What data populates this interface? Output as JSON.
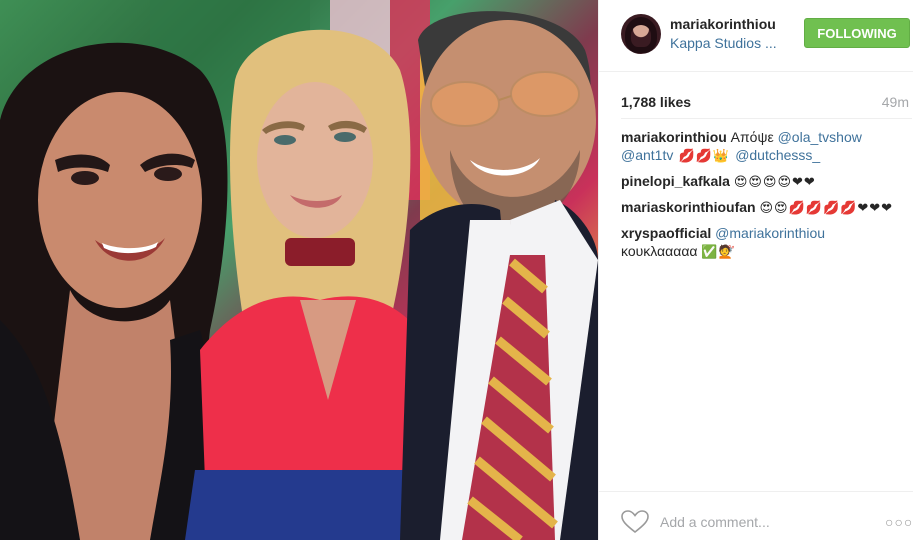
{
  "post": {
    "photo_alt": "",
    "username": "mariakorinthiou",
    "location": "Kappa Studios ...",
    "follow_label": "FOLLOWING",
    "likes": "1,788 likes",
    "age": "49m",
    "add_comment_placeholder": "Add a comment...",
    "more_label": "○○○"
  },
  "caption": {
    "user": "mariakorinthiou",
    "text_1": " Απόψε ",
    "mention_1": "@ola_tvshow",
    "mention_2": "@ant1tv",
    "emoji_1": " 💋💋👑 ",
    "mention_3": "@dutchesss_"
  },
  "comments": [
    {
      "user": "pinelopi_kafkala",
      "emoji": "😍😍😍😍❤❤"
    },
    {
      "user": "mariaskorinthioufan",
      "emoji": "😍😍💋💋💋💋❤❤❤"
    },
    {
      "user": "xryspaofficial",
      "mention": "@mariakorinthiou",
      "text": "κουκλααααα",
      "emoji": "✅💇"
    }
  ],
  "colors": {
    "follow_bg": "#70c050",
    "link": "#3f729b",
    "muted": "#a5a7aa"
  }
}
